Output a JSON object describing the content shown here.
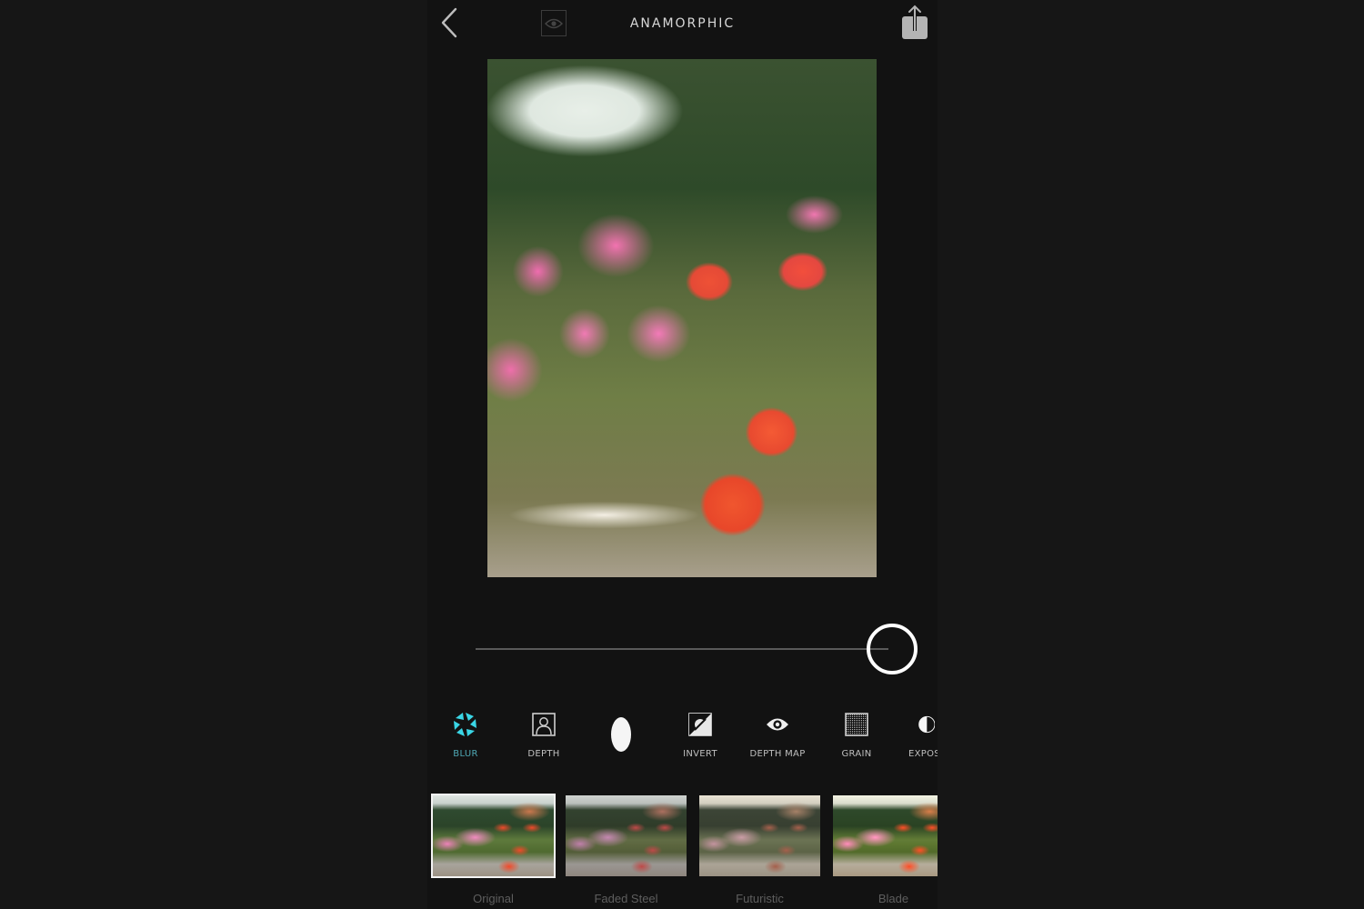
{
  "header": {
    "title": "ANAMORPHIC",
    "back_icon": "chevron-left-icon",
    "preview_icon": "eye-icon",
    "share_icon": "share-icon"
  },
  "photo": {
    "description": "Blurred flower bed with pink and orange petunias"
  },
  "slider": {
    "value_percent": 100
  },
  "tools": [
    {
      "label": "BLUR",
      "icon": "aperture-icon",
      "active": true
    },
    {
      "label": "DEPTH",
      "icon": "portrait-icon",
      "active": false
    },
    {
      "label": "",
      "icon": "bokeh-shape-icon",
      "active": false
    },
    {
      "label": "INVERT",
      "icon": "invert-icon",
      "active": false
    },
    {
      "label": "DEPTH MAP",
      "icon": "eye-icon",
      "active": false
    },
    {
      "label": "GRAIN",
      "icon": "grain-icon",
      "active": false
    },
    {
      "label": "EXPOS",
      "icon": "exposure-icon",
      "active": false
    }
  ],
  "filters": [
    {
      "label": "Original",
      "selected": true
    },
    {
      "label": "Faded Steel",
      "selected": false
    },
    {
      "label": "Futuristic",
      "selected": false
    },
    {
      "label": "Blade",
      "selected": false
    }
  ],
  "colors": {
    "accent": "#3ad6e6",
    "accent_label": "#4fa8b4",
    "background": "#121212",
    "outer_background": "#161616"
  }
}
